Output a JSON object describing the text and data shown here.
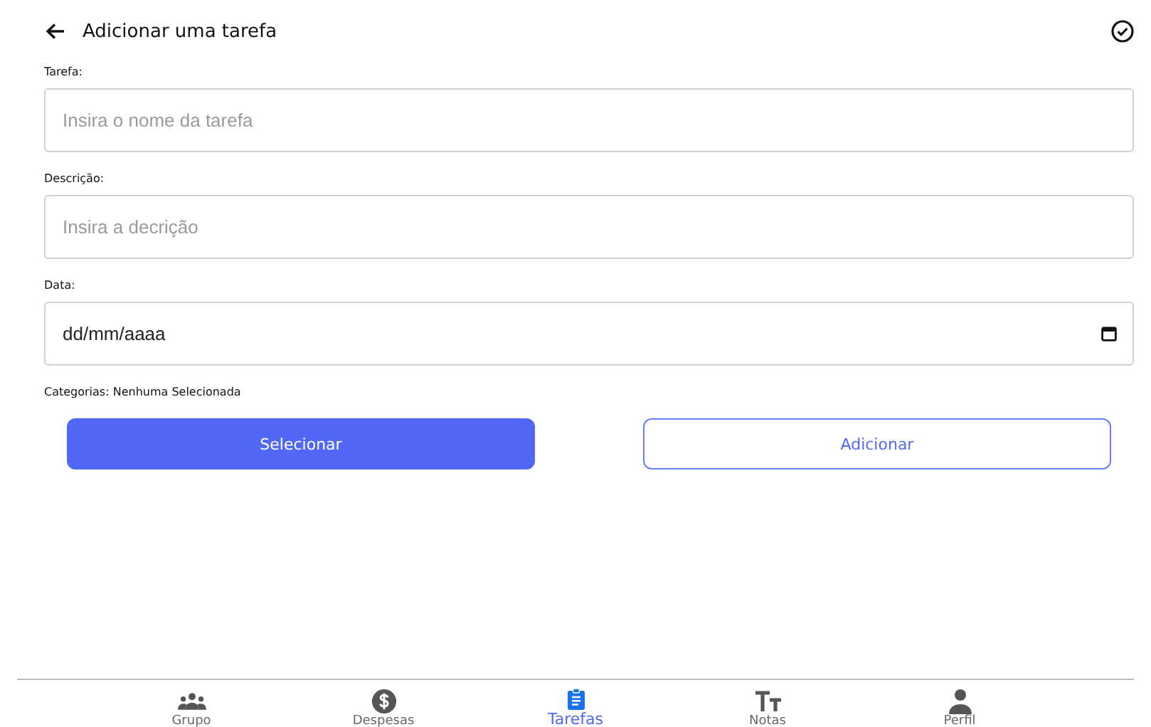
{
  "header": {
    "title": "Adicionar uma tarefa"
  },
  "fields": [
    {
      "kind": "text",
      "label": "Tarefa:",
      "placeholder": "Insira o nome da tarefa"
    },
    {
      "kind": "text",
      "label": "Descrição:",
      "placeholder": "Insira a decrição"
    },
    {
      "kind": "date",
      "label": "Data:",
      "value": "dd/mm/aaaa"
    }
  ],
  "categories": "Categorias: Nenhuma Selecionada",
  "buttons": [
    {
      "label": "Selecionar",
      "kind": "primary"
    },
    {
      "label": "Adicionar",
      "kind": "outline"
    }
  ],
  "nav": [
    {
      "label": "Grupo",
      "kind": "group",
      "selected": false
    },
    {
      "label": "Despesas",
      "kind": "dollar",
      "selected": false
    },
    {
      "label": "Tarefas",
      "kind": "clipboard",
      "selected": true
    },
    {
      "label": "Notas",
      "kind": "text",
      "selected": false
    },
    {
      "label": "Perfil",
      "kind": "person",
      "selected": false
    }
  ]
}
